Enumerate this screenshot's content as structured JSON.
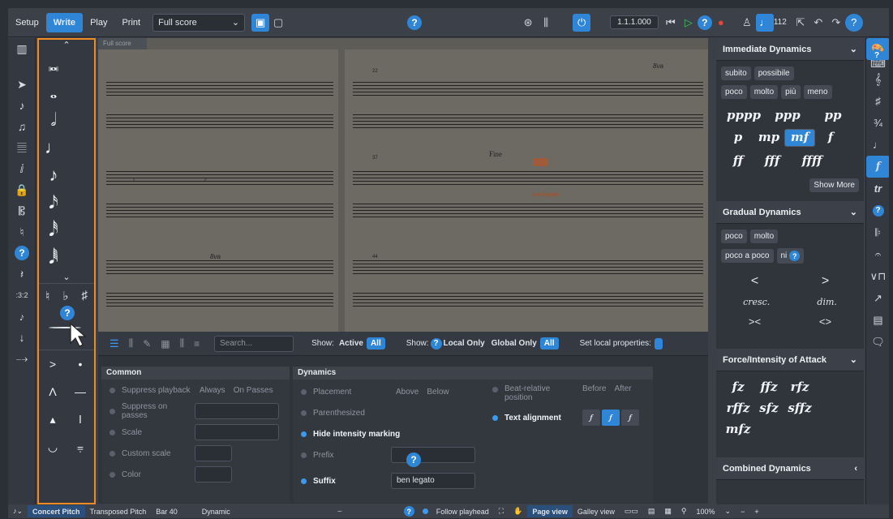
{
  "topbar": {
    "modes": [
      "Setup",
      "Write",
      "Play",
      "Print"
    ],
    "active_mode": "Write",
    "layout_select": "Full score",
    "position": "1.1.1.000",
    "tempo": "112"
  },
  "score": {
    "tab": "Full score",
    "fine": "Fine",
    "legato": "ben legato",
    "ottava": "8va",
    "bar_numbers": [
      "22",
      "37",
      "44"
    ],
    "endings": [
      "1.",
      "2."
    ]
  },
  "notes_panel": {
    "accidentals": [
      "♮",
      "♭",
      "♯"
    ]
  },
  "lower": {
    "search_placeholder": "Search...",
    "show_label": "Show:",
    "active": "Active",
    "all": "All",
    "show2_label": "Show:",
    "local_only": "Local Only",
    "global_only": "Global Only",
    "all2": "All",
    "set_local": "Set local properties:",
    "common": {
      "title": "Common",
      "rows": [
        "Suppress playback",
        "Suppress on passes",
        "Scale",
        "Custom scale",
        "Color"
      ],
      "always": "Always",
      "on_passes": "On Passes"
    },
    "dynamics": {
      "title": "Dynamics",
      "placement": "Placement",
      "above": "Above",
      "below": "Below",
      "parenthesized": "Parenthesized",
      "hide_intensity": "Hide intensity marking",
      "prefix": "Prefix",
      "suffix": "Suffix",
      "suffix_value": "ben legato",
      "beat_relative": "Beat-relative position",
      "before": "Before",
      "after": "After",
      "text_alignment": "Text alignment"
    }
  },
  "right": {
    "immediate": {
      "title": "Immediate Dynamics",
      "chips1": [
        "subito",
        "possibile"
      ],
      "chips2": [
        "poco",
        "molto",
        "più",
        "meno"
      ],
      "dyn": [
        "pppp",
        "ppp",
        "pp",
        "p",
        "mp",
        "mf",
        "f",
        "ff",
        "fff",
        "ffff"
      ],
      "selected": "mf",
      "show_more": "Show More"
    },
    "gradual": {
      "title": "Gradual Dynamics",
      "chips1": [
        "poco",
        "molto"
      ],
      "chips2": [
        "poco a poco",
        "ni"
      ],
      "cresc": "cresc.",
      "dim": "dim."
    },
    "force": {
      "title": "Force/Intensity of Attack",
      "dyn": [
        "fz",
        "ffz",
        "rfz",
        "rffz",
        "sfz",
        "sffz",
        "mfz"
      ]
    },
    "combined": {
      "title": "Combined Dynamics"
    }
  },
  "status": {
    "concert": "Concert Pitch",
    "transposed": "Transposed Pitch",
    "bar": "Bar 40",
    "dynamic": "Dynamic",
    "follow": "Follow playhead",
    "page_view": "Page view",
    "galley_view": "Galley view",
    "zoom": "100%"
  },
  "colors": {
    "accent": "#2f86d6",
    "focus": "#f08a24"
  }
}
